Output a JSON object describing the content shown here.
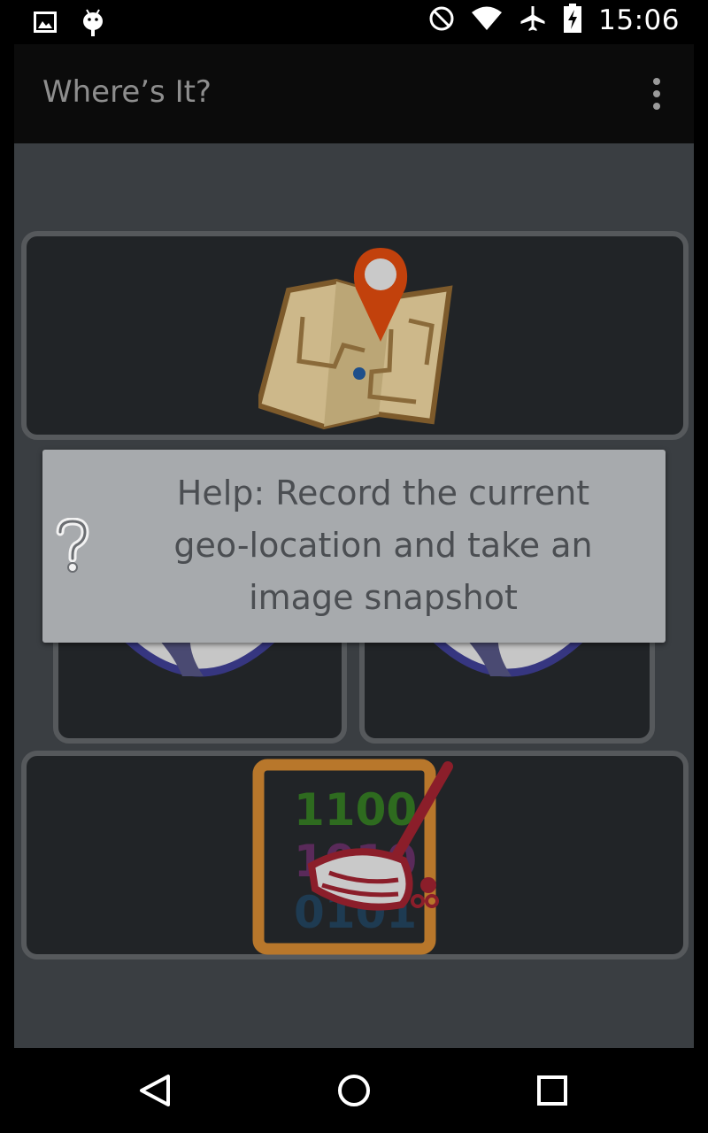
{
  "status_bar": {
    "time": "15:06",
    "icons": [
      "image-notification-icon",
      "android-notification-icon",
      "do-not-disturb-icon",
      "wifi-icon",
      "airplane-mode-icon",
      "battery-charging-icon"
    ]
  },
  "app_bar": {
    "title": "Where’s It?",
    "overflow_icon": "more-vert-icon"
  },
  "cards": [
    {
      "name": "record-location-card",
      "icon": "map-pin-icon"
    },
    {
      "name": "globe-card-left",
      "icon": "globe-icon"
    },
    {
      "name": "globe-card-right",
      "icon": "globe-icon"
    },
    {
      "name": "clear-data-card",
      "icon": "broom-binary-icon",
      "icon_text": [
        "1100",
        "1010",
        "0101"
      ]
    }
  ],
  "help_toast": {
    "icon": "question-mark-icon",
    "text": "Help: Record the current geo-location and take an image snapshot"
  },
  "nav_bar": {
    "buttons": [
      "back-icon",
      "home-icon",
      "recents-icon"
    ]
  },
  "colors": {
    "overlay_bg": "#3a3e42",
    "card_bg": "#212427",
    "toast_bg": "#a7aaad",
    "pin": "#c2410c",
    "map": "#cdb88a",
    "frame": "#b8772b",
    "broom": "#8b1e2a"
  }
}
